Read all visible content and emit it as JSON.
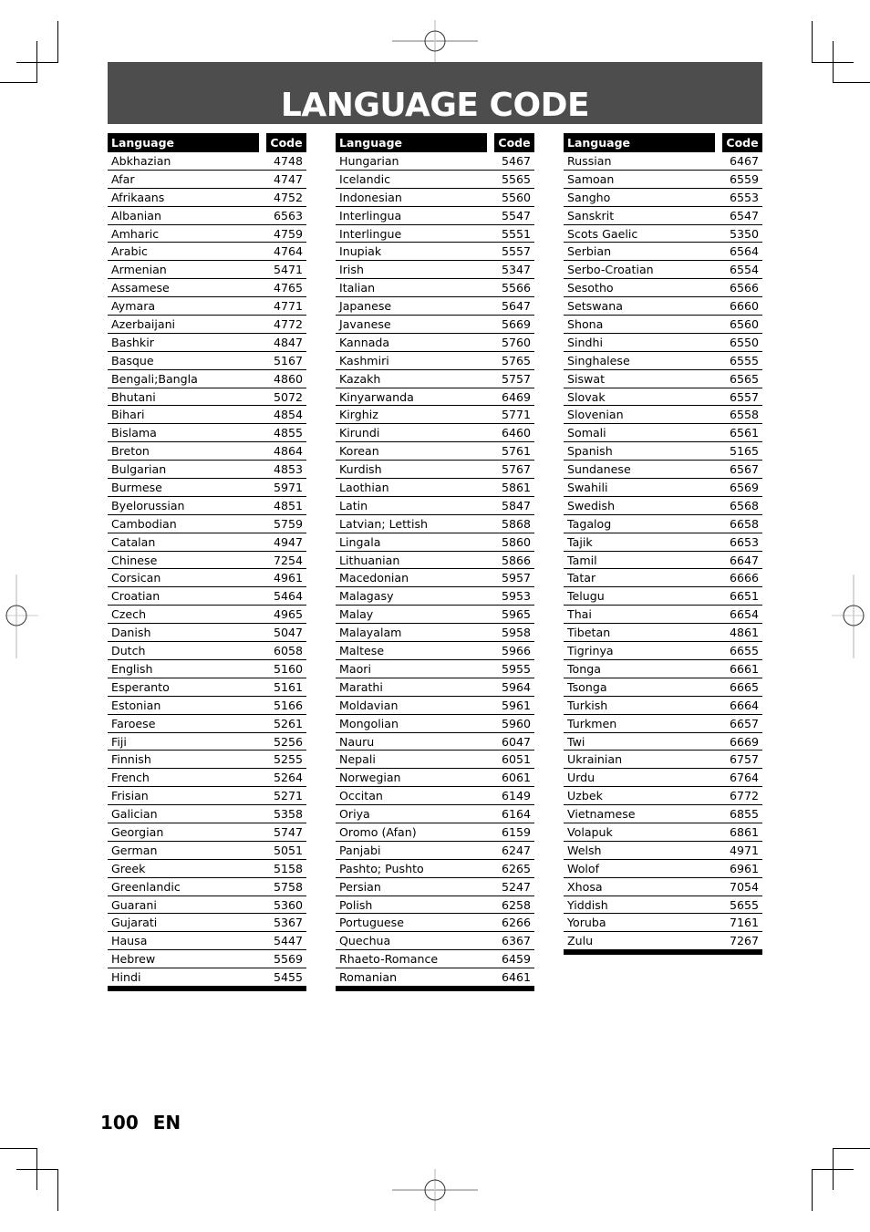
{
  "page": {
    "title": "LANGUAGE CODE",
    "page_number": "100",
    "language_tag": "EN"
  },
  "table_headers": {
    "language": "Language",
    "code": "Code"
  },
  "columns": [
    {
      "rows": [
        {
          "language": "Abkhazian",
          "code": "4748"
        },
        {
          "language": "Afar",
          "code": "4747"
        },
        {
          "language": "Afrikaans",
          "code": "4752"
        },
        {
          "language": "Albanian",
          "code": "6563"
        },
        {
          "language": "Amharic",
          "code": "4759"
        },
        {
          "language": "Arabic",
          "code": "4764"
        },
        {
          "language": "Armenian",
          "code": "5471"
        },
        {
          "language": "Assamese",
          "code": "4765"
        },
        {
          "language": "Aymara",
          "code": "4771"
        },
        {
          "language": "Azerbaijani",
          "code": "4772"
        },
        {
          "language": "Bashkir",
          "code": "4847"
        },
        {
          "language": "Basque",
          "code": "5167"
        },
        {
          "language": "Bengali;Bangla",
          "code": "4860"
        },
        {
          "language": "Bhutani",
          "code": "5072"
        },
        {
          "language": "Bihari",
          "code": "4854"
        },
        {
          "language": "Bislama",
          "code": "4855"
        },
        {
          "language": "Breton",
          "code": "4864"
        },
        {
          "language": "Bulgarian",
          "code": "4853"
        },
        {
          "language": "Burmese",
          "code": "5971"
        },
        {
          "language": "Byelorussian",
          "code": "4851"
        },
        {
          "language": "Cambodian",
          "code": "5759"
        },
        {
          "language": "Catalan",
          "code": "4947"
        },
        {
          "language": "Chinese",
          "code": "7254"
        },
        {
          "language": "Corsican",
          "code": "4961"
        },
        {
          "language": "Croatian",
          "code": "5464"
        },
        {
          "language": "Czech",
          "code": "4965"
        },
        {
          "language": "Danish",
          "code": "5047"
        },
        {
          "language": "Dutch",
          "code": "6058"
        },
        {
          "language": "English",
          "code": "5160"
        },
        {
          "language": "Esperanto",
          "code": "5161"
        },
        {
          "language": "Estonian",
          "code": "5166"
        },
        {
          "language": "Faroese",
          "code": "5261"
        },
        {
          "language": "Fiji",
          "code": "5256"
        },
        {
          "language": "Finnish",
          "code": "5255"
        },
        {
          "language": "French",
          "code": "5264"
        },
        {
          "language": "Frisian",
          "code": "5271"
        },
        {
          "language": "Galician",
          "code": "5358"
        },
        {
          "language": "Georgian",
          "code": "5747"
        },
        {
          "language": "German",
          "code": "5051"
        },
        {
          "language": "Greek",
          "code": "5158"
        },
        {
          "language": "Greenlandic",
          "code": "5758"
        },
        {
          "language": "Guarani",
          "code": "5360"
        },
        {
          "language": "Gujarati",
          "code": "5367"
        },
        {
          "language": "Hausa",
          "code": "5447"
        },
        {
          "language": "Hebrew",
          "code": "5569"
        },
        {
          "language": "Hindi",
          "code": "5455"
        }
      ]
    },
    {
      "rows": [
        {
          "language": "Hungarian",
          "code": "5467"
        },
        {
          "language": "Icelandic",
          "code": "5565"
        },
        {
          "language": "Indonesian",
          "code": "5560"
        },
        {
          "language": "Interlingua",
          "code": "5547"
        },
        {
          "language": "Interlingue",
          "code": "5551"
        },
        {
          "language": "Inupiak",
          "code": "5557"
        },
        {
          "language": "Irish",
          "code": "5347"
        },
        {
          "language": "Italian",
          "code": "5566"
        },
        {
          "language": "Japanese",
          "code": "5647"
        },
        {
          "language": "Javanese",
          "code": "5669"
        },
        {
          "language": "Kannada",
          "code": "5760"
        },
        {
          "language": "Kashmiri",
          "code": "5765"
        },
        {
          "language": "Kazakh",
          "code": "5757"
        },
        {
          "language": "Kinyarwanda",
          "code": "6469"
        },
        {
          "language": "Kirghiz",
          "code": "5771"
        },
        {
          "language": "Kirundi",
          "code": "6460"
        },
        {
          "language": "Korean",
          "code": "5761"
        },
        {
          "language": "Kurdish",
          "code": "5767"
        },
        {
          "language": "Laothian",
          "code": "5861"
        },
        {
          "language": "Latin",
          "code": "5847"
        },
        {
          "language": "Latvian; Lettish",
          "code": "5868"
        },
        {
          "language": "Lingala",
          "code": "5860"
        },
        {
          "language": "Lithuanian",
          "code": "5866"
        },
        {
          "language": "Macedonian",
          "code": "5957"
        },
        {
          "language": "Malagasy",
          "code": "5953"
        },
        {
          "language": "Malay",
          "code": "5965"
        },
        {
          "language": "Malayalam",
          "code": "5958"
        },
        {
          "language": "Maltese",
          "code": "5966"
        },
        {
          "language": "Maori",
          "code": "5955"
        },
        {
          "language": "Marathi",
          "code": "5964"
        },
        {
          "language": "Moldavian",
          "code": "5961"
        },
        {
          "language": "Mongolian",
          "code": "5960"
        },
        {
          "language": "Nauru",
          "code": "6047"
        },
        {
          "language": "Nepali",
          "code": "6051"
        },
        {
          "language": "Norwegian",
          "code": "6061"
        },
        {
          "language": "Occitan",
          "code": "6149"
        },
        {
          "language": "Oriya",
          "code": "6164"
        },
        {
          "language": "Oromo (Afan)",
          "code": "6159"
        },
        {
          "language": "Panjabi",
          "code": "6247"
        },
        {
          "language": "Pashto; Pushto",
          "code": "6265"
        },
        {
          "language": "Persian",
          "code": "5247"
        },
        {
          "language": "Polish",
          "code": "6258"
        },
        {
          "language": "Portuguese",
          "code": "6266"
        },
        {
          "language": "Quechua",
          "code": "6367"
        },
        {
          "language": "Rhaeto-Romance",
          "code": "6459"
        },
        {
          "language": "Romanian",
          "code": "6461"
        }
      ]
    },
    {
      "rows": [
        {
          "language": "Russian",
          "code": "6467"
        },
        {
          "language": "Samoan",
          "code": "6559"
        },
        {
          "language": "Sangho",
          "code": "6553"
        },
        {
          "language": "Sanskrit",
          "code": "6547"
        },
        {
          "language": "Scots Gaelic",
          "code": "5350"
        },
        {
          "language": "Serbian",
          "code": "6564"
        },
        {
          "language": "Serbo-Croatian",
          "code": "6554"
        },
        {
          "language": "Sesotho",
          "code": "6566"
        },
        {
          "language": "Setswana",
          "code": "6660"
        },
        {
          "language": "Shona",
          "code": "6560"
        },
        {
          "language": "Sindhi",
          "code": "6550"
        },
        {
          "language": "Singhalese",
          "code": "6555"
        },
        {
          "language": "Siswat",
          "code": "6565"
        },
        {
          "language": "Slovak",
          "code": "6557"
        },
        {
          "language": "Slovenian",
          "code": "6558"
        },
        {
          "language": "Somali",
          "code": "6561"
        },
        {
          "language": "Spanish",
          "code": "5165"
        },
        {
          "language": "Sundanese",
          "code": "6567"
        },
        {
          "language": "Swahili",
          "code": "6569"
        },
        {
          "language": "Swedish",
          "code": "6568"
        },
        {
          "language": "Tagalog",
          "code": "6658"
        },
        {
          "language": "Tajik",
          "code": "6653"
        },
        {
          "language": "Tamil",
          "code": "6647"
        },
        {
          "language": "Tatar",
          "code": "6666"
        },
        {
          "language": "Telugu",
          "code": "6651"
        },
        {
          "language": "Thai",
          "code": "6654"
        },
        {
          "language": "Tibetan",
          "code": "4861"
        },
        {
          "language": "Tigrinya",
          "code": "6655"
        },
        {
          "language": "Tonga",
          "code": "6661"
        },
        {
          "language": "Tsonga",
          "code": "6665"
        },
        {
          "language": "Turkish",
          "code": "6664"
        },
        {
          "language": "Turkmen",
          "code": "6657"
        },
        {
          "language": "Twi",
          "code": "6669"
        },
        {
          "language": "Ukrainian",
          "code": "6757"
        },
        {
          "language": "Urdu",
          "code": "6764"
        },
        {
          "language": "Uzbek",
          "code": "6772"
        },
        {
          "language": "Vietnamese",
          "code": "6855"
        },
        {
          "language": "Volapuk",
          "code": "6861"
        },
        {
          "language": "Welsh",
          "code": "4971"
        },
        {
          "language": "Wolof",
          "code": "6961"
        },
        {
          "language": "Xhosa",
          "code": "7054"
        },
        {
          "language": "Yiddish",
          "code": "5655"
        },
        {
          "language": "Yoruba",
          "code": "7161"
        },
        {
          "language": "Zulu",
          "code": "7267"
        }
      ]
    }
  ]
}
